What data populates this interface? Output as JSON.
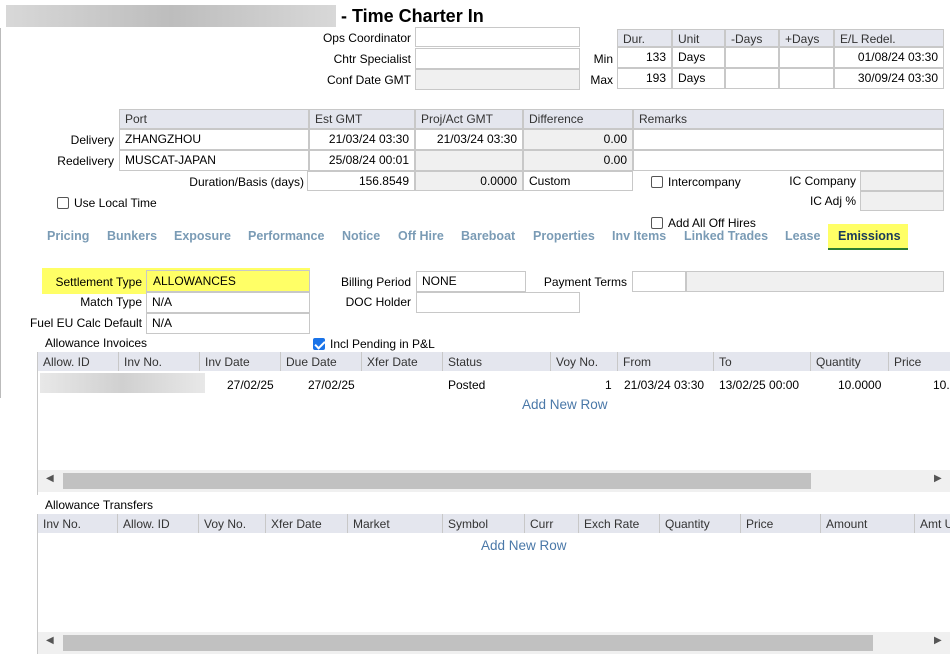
{
  "title": "- Time Charter In",
  "top_labels": {
    "ops_coordinator": "Ops Coordinator",
    "chtr_specialist": "Chtr Specialist",
    "conf_date_gmt": "Conf Date GMT"
  },
  "duration_table": {
    "headers": [
      "Dur.",
      "Unit",
      "-Days",
      "+Days",
      "E/L Redel."
    ],
    "rows": [
      {
        "label": "Min",
        "dur": "133",
        "unit": "Days",
        "minus": "",
        "plus": "",
        "redel": "01/08/24 03:30"
      },
      {
        "label": "Max",
        "dur": "193",
        "unit": "Days",
        "minus": "",
        "plus": "",
        "redel": "30/09/24 03:30"
      }
    ]
  },
  "port_table": {
    "headers": [
      "Port",
      "Est GMT",
      "Proj/Act GMT",
      "Difference",
      "Remarks"
    ],
    "rows": [
      {
        "label": "Delivery",
        "port": "ZHANGZHOU",
        "est": "21/03/24 03:30",
        "proj": "21/03/24 03:30",
        "diff": "0.00",
        "remarks": ""
      },
      {
        "label": "Redelivery",
        "port": "MUSCAT-JAPAN",
        "est": "25/08/24 00:01",
        "proj": "",
        "diff": "0.00",
        "remarks": ""
      }
    ],
    "duration_label": "Duration/Basis (days)",
    "duration_value": "156.8549",
    "basis_value": "0.0000",
    "basis_type": "Custom"
  },
  "checkboxes": {
    "intercompany": "Intercompany",
    "use_local_time": "Use Local Time",
    "add_all_off_hires": "Add All Off Hires",
    "incl_pending": "Incl Pending in P&L"
  },
  "ic": {
    "company_label": "IC Company",
    "adj_label": "IC Adj %"
  },
  "tabs": [
    "Pricing",
    "Bunkers",
    "Exposure",
    "Performance",
    "Notice",
    "Off Hire",
    "Bareboat",
    "Properties",
    "Inv Items",
    "Linked Trades",
    "Lease",
    "Emissions"
  ],
  "active_tab": "Emissions",
  "settlement": {
    "settlement_type_label": "Settlement Type",
    "settlement_type": "ALLOWANCES",
    "match_type_label": "Match Type",
    "match_type": "N/A",
    "fuel_eu_label": "Fuel EU Calc Default",
    "fuel_eu": "N/A",
    "billing_period_label": "Billing Period",
    "billing_period": "NONE",
    "doc_holder_label": "DOC Holder",
    "doc_holder": "",
    "payment_terms_label": "Payment Terms"
  },
  "allowance_invoices": {
    "title": "Allowance Invoices",
    "columns": [
      "Allow. ID",
      "Inv No.",
      "Inv Date",
      "Due Date",
      "Xfer Date",
      "Status",
      "Voy No.",
      "From",
      "To",
      "Quantity",
      "Price"
    ],
    "row": {
      "inv_date": "27/02/25",
      "due_date": "27/02/25",
      "status": "Posted",
      "voy_no": "1",
      "from": "21/03/24 03:30",
      "to": "13/02/25 00:00",
      "quantity": "10.0000",
      "price": "10."
    },
    "add_row": "Add New Row"
  },
  "allowance_transfers": {
    "title": "Allowance Transfers",
    "columns": [
      "Inv No.",
      "Allow. ID",
      "Voy No.",
      "Xfer Date",
      "Market",
      "Symbol",
      "Curr",
      "Exch Rate",
      "Quantity",
      "Price",
      "Amount",
      "Amt U"
    ],
    "add_row": "Add New Row"
  },
  "colors": {
    "highlight": "#ffff66",
    "tab_text": "#7a9bb5",
    "active_underline": "#2e7d32",
    "header_bg": "#e4e6ee"
  }
}
